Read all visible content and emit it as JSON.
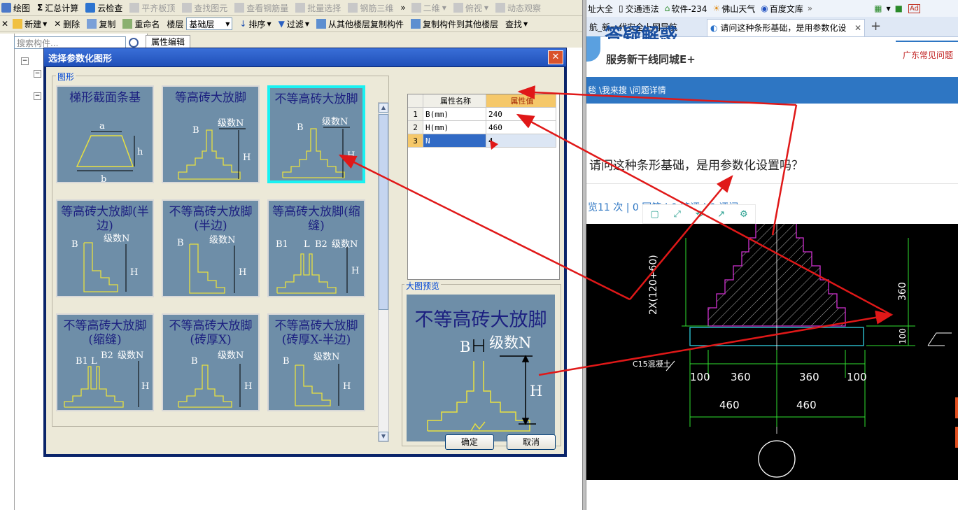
{
  "toolbar1": {
    "items": [
      "绘图",
      "汇总计算",
      "云检查",
      "平齐板顶",
      "查找图元",
      "查看钢筋量",
      "批量选择",
      "钢筋三维",
      "二维",
      "俯视",
      "动态观察"
    ]
  },
  "toolbar2": {
    "new_label": "新建",
    "delete_label": "删除",
    "copy_label": "复制",
    "rename_label": "重命名",
    "floor_label": "楼层",
    "floor_value": "基础层",
    "sort_label": "排序",
    "filter_label": "过滤",
    "copy_from_floor_label": "从其他楼层复制构件",
    "copy_to_floor_label": "复制构件到其他楼层",
    "find_label": "查找"
  },
  "left_panel": {
    "search_placeholder": "搜索构件...",
    "tab_label": "属性编辑"
  },
  "dialog": {
    "title": "选择参数化图形",
    "shape_group_label": "图形",
    "tiles": [
      {
        "title": "梯形截面条基",
        "labels": {
          "a": "a",
          "b": "b",
          "h": "h"
        }
      },
      {
        "title": "等高砖大放脚",
        "labels": {
          "B": "B",
          "N": "级数N",
          "H": "H"
        }
      },
      {
        "title": "不等高砖大放脚",
        "labels": {
          "B": "B",
          "N": "级数N",
          "H": "H"
        }
      },
      {
        "title": "等高砖大放脚(半边)",
        "labels": {
          "B": "B",
          "N": "级数N",
          "H": "H"
        }
      },
      {
        "title": "不等高砖大放脚(半边)",
        "labels": {
          "B": "B",
          "N": "级数N",
          "H": "H"
        }
      },
      {
        "title": "等高砖大放脚(缩缝)",
        "labels": {
          "B": "B1",
          "B2": "B2",
          "L": "L",
          "N": "级数N",
          "H": "H"
        }
      },
      {
        "title": "不等高砖大放脚(缩缝)",
        "labels": {
          "B": "B1",
          "B2": "B2",
          "L": "L",
          "N": "级数N",
          "H": "H"
        }
      },
      {
        "title": "不等高砖大放脚(砖厚X)",
        "labels": {
          "B": "B",
          "N": "级数N",
          "H": "H"
        }
      },
      {
        "title": "不等高砖大放脚(砖厚X-半边)",
        "labels": {
          "B": "B",
          "N": "级数N",
          "H": "H"
        }
      }
    ],
    "selected_tile": 2,
    "property_table": {
      "headers": [
        "属性名称",
        "属性值"
      ],
      "rows": [
        {
          "num": "1",
          "name": "B(mm)",
          "value": "240"
        },
        {
          "num": "2",
          "name": "H(mm)",
          "value": "460"
        },
        {
          "num": "3",
          "name": "N",
          "value": "4"
        }
      ]
    },
    "preview_label": "大图预览",
    "preview": {
      "title": "不等高砖大放脚",
      "B": "B",
      "N": "级数N",
      "H": "H"
    },
    "ok_label": "确定",
    "cancel_label": "取消"
  },
  "browser": {
    "favorites": [
      "址大全",
      "交通违法",
      "软件-234",
      "佛山天气",
      "百度文库"
    ],
    "tabs": [
      "航_新一代安全上网导航",
      "请问这种条形基础，是用参数化设"
    ],
    "site_title": "答疑解惑",
    "site_slogan": "服务新干线同城E+",
    "right_link": "广东常见问题",
    "breadcrumb": "毯 \\我来搜 \\问题详情",
    "question": "请问这种条形基础，是用参数化设置吗？",
    "stats": "览11 次 | 0 回答 | 0 简评 | 0 评问",
    "cad": {
      "vertical_dim": "2X(120+60)",
      "dim_360_right": "360",
      "dim_100_right": "100",
      "concrete_label": "C15混凝土",
      "bottom_dims": [
        "100",
        "360",
        "360",
        "100"
      ],
      "half_dims": [
        "460",
        "460"
      ]
    }
  },
  "colors": {
    "tile_bg": "#6e8ea8",
    "tile_title": "#1c2080",
    "selected_border": "#19f2f2",
    "brick_outline": "#e8e040",
    "annotation_arrow": "#e01818",
    "header_highlight": "#f5c86a",
    "selected_row": "#316ac5"
  }
}
